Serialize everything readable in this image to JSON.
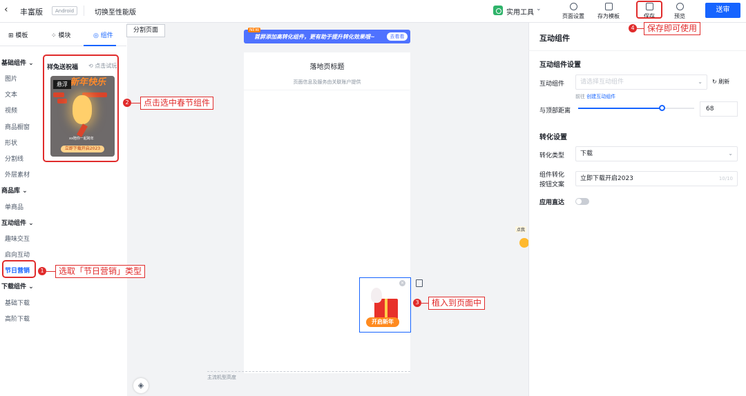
{
  "topbar": {
    "back": "‹",
    "edition": "丰富版",
    "platform": "Android",
    "switch_perf": "切换至性能版",
    "tools_label": "实用工具",
    "page_settings": "页面设置",
    "save_template": "存为模板",
    "save": "保存",
    "preview": "预览",
    "submit": "送审"
  },
  "left_tabs": [
    "模板",
    "模块",
    "组件"
  ],
  "categories": {
    "basic": "基础组件",
    "basic_items": [
      "图片",
      "文本",
      "视频",
      "商品橱窗",
      "形状",
      "分割线",
      "外层素材"
    ],
    "goods": "商品库",
    "goods_items": [
      "单商品"
    ],
    "interactive": "互动组件",
    "interactive_items": [
      "趣味交互",
      "启向互动",
      "节日营销"
    ],
    "download": "下载组件",
    "download_items": [
      "基础下载",
      "高阶下载"
    ]
  },
  "component": {
    "title": "祥兔送祝福",
    "try": "点击试玩",
    "thumb_title": "新年快乐",
    "float_label": "悬浮",
    "thumb_tag": "xx陪你一起跨年",
    "thumb_btn": "立即下载开启2023"
  },
  "canvas": {
    "split_tab": "分割页面",
    "banner_new": "NEW",
    "banner_text": "首屏添加高转化组件，更有助于提升转化效果哦~",
    "banner_go": "去看看",
    "page_title": "落地页标题",
    "page_sub": "页面信息及服务由关联账户提供",
    "widget_btn": "开启新年",
    "footer": "主流机型高度",
    "peek": "点我"
  },
  "right": {
    "title": "互动组件",
    "sec1": "互动组件设置",
    "component_label": "互动组件",
    "component_placeholder": "请选择互动组件",
    "refresh": "刷新",
    "goto": "前往",
    "create": "创建互动组件",
    "distance_label": "与顶部距离",
    "distance_value": "68",
    "sec2": "转化设置",
    "conv_type_label": "转化类型",
    "conv_type_value": "下载",
    "btn_text_label1": "组件转化",
    "btn_text_label2": "按钮文案",
    "btn_text_value": "立即下载开启2023",
    "btn_text_count": "10/10",
    "direct_label": "应用直达",
    "direct_on": false,
    "distance_fraction": 0.72
  },
  "annotations": [
    {
      "num": "1",
      "text": "选取「节日营销」类型"
    },
    {
      "num": "2",
      "text": "点击选中春节组件"
    },
    {
      "num": "3",
      "text": "植入到页面中"
    },
    {
      "num": "4",
      "text": "保存即可使用"
    }
  ],
  "colors": {
    "accent": "#1664ff",
    "annotation": "#e02b2b"
  }
}
